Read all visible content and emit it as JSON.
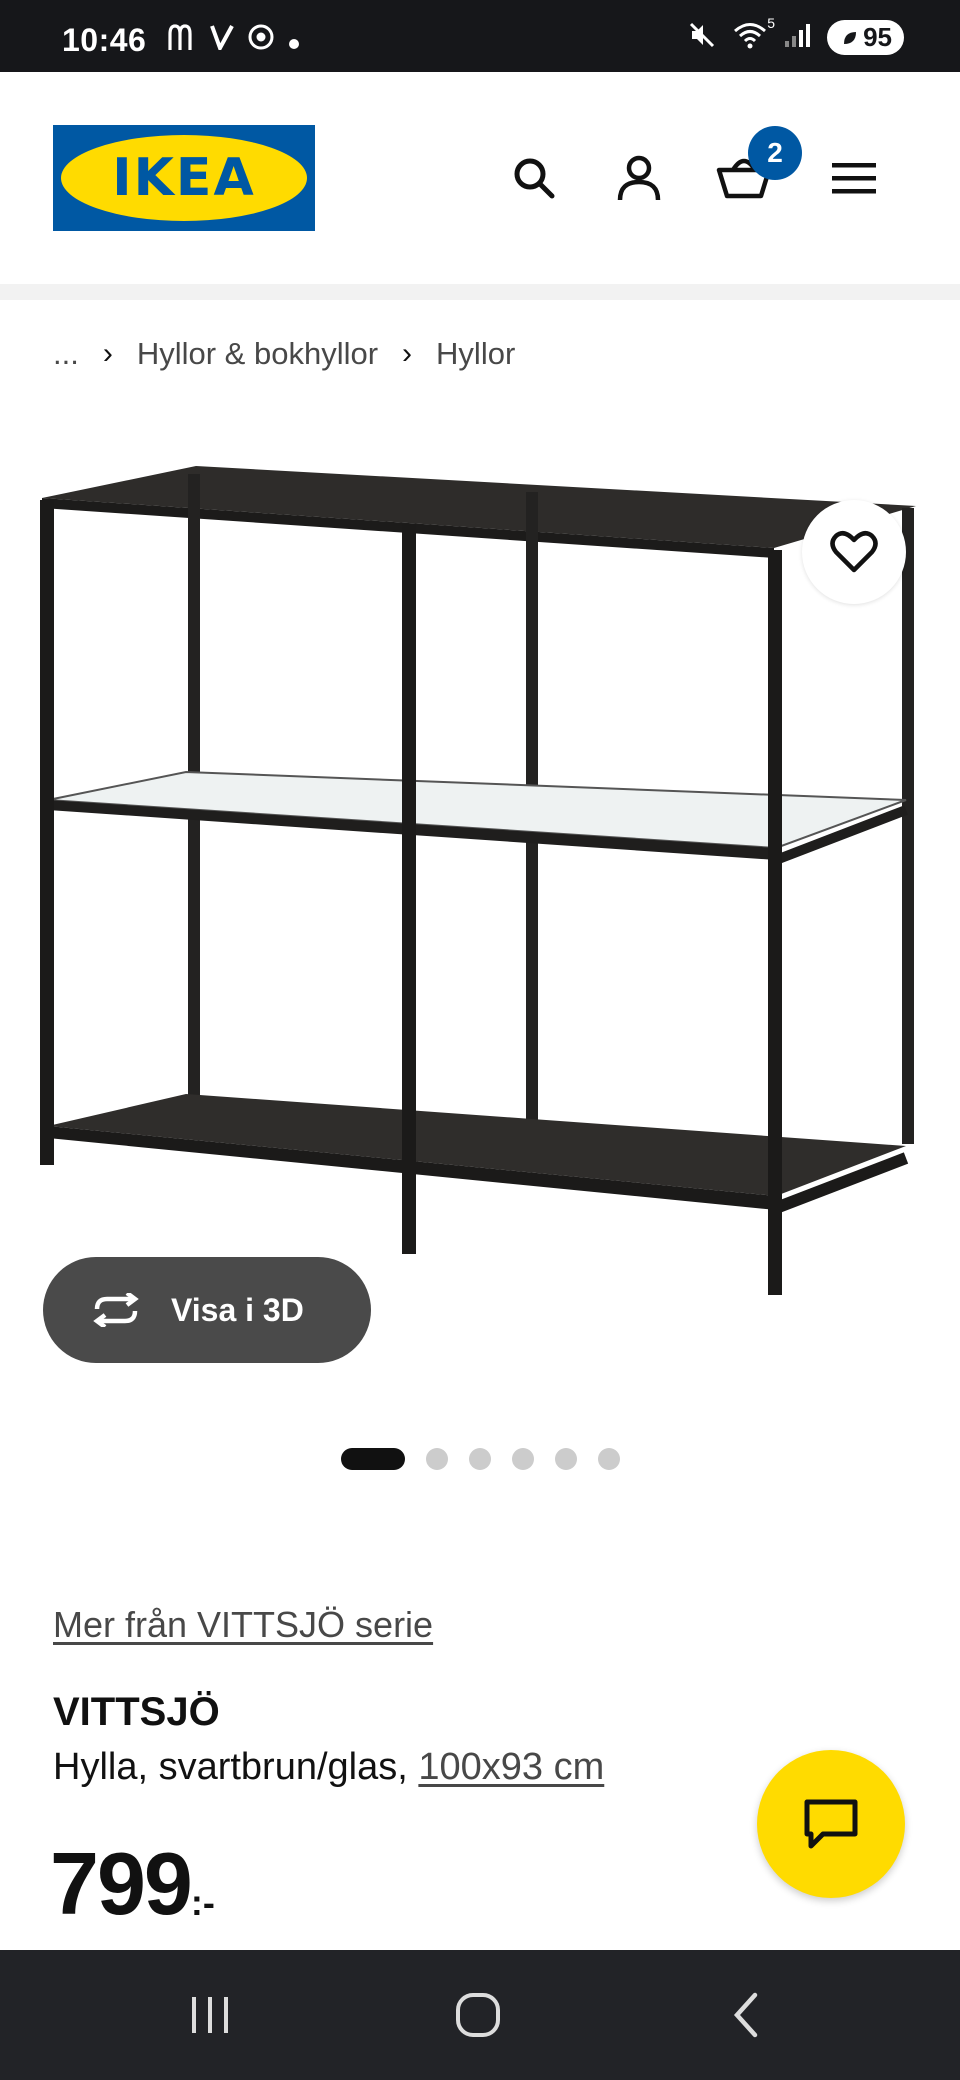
{
  "status_bar": {
    "time": "10:46",
    "left_icons": [
      "mcdonalds-icon",
      "v-app-icon",
      "chrome-icon",
      "dot-icon"
    ],
    "right_icons": [
      "mute-icon",
      "wifi-icon",
      "signal-icon"
    ],
    "network_label": "5",
    "battery": "95"
  },
  "header": {
    "logo_text": "IKEA",
    "cart_count": "2",
    "icons": [
      "search-icon",
      "account-icon",
      "cart-icon",
      "menu-icon"
    ],
    "colors": {
      "brand_blue": "#0058a3",
      "brand_yellow": "#ffdb00"
    }
  },
  "breadcrumb": {
    "items": [
      "...",
      "Hyllor & bokhyllor",
      "Hyllor"
    ]
  },
  "gallery": {
    "view_3d_label": "Visa i 3D",
    "total_images": 6,
    "active_index": 0
  },
  "product": {
    "series_link": "Mer från VITTSJÖ serie",
    "name": "VITTSJÖ",
    "description": "Hylla, svartbrun/glas, ",
    "size": "100x93 cm",
    "price": "799",
    "price_suffix": ":-"
  },
  "nav_bar": {
    "buttons": [
      "recents-icon",
      "home-icon",
      "back-icon"
    ]
  }
}
